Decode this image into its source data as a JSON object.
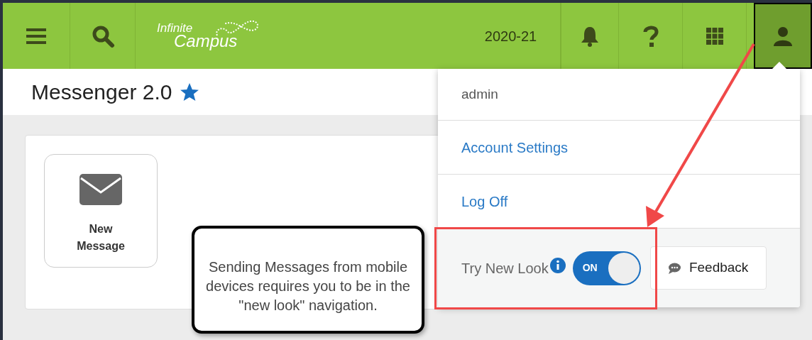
{
  "header": {
    "logo": {
      "line_1": "Infinite",
      "line_2": "Campus"
    },
    "year": "2020-21"
  },
  "page_title": {
    "text": "Messenger 2.0",
    "favorite": true
  },
  "tiles": [
    {
      "label": "New Message"
    }
  ],
  "user_menu": {
    "expanded": true,
    "username": "admin",
    "links": [
      {
        "label": "Account Settings"
      },
      {
        "label": "Log Off"
      }
    ],
    "new_look": {
      "label": "Try New Look",
      "on": true,
      "state_text": "ON"
    },
    "feedback": "Feedback"
  },
  "callout": "Sending Messages from mobile devices requires you to be in the \"new look\" navigation."
}
